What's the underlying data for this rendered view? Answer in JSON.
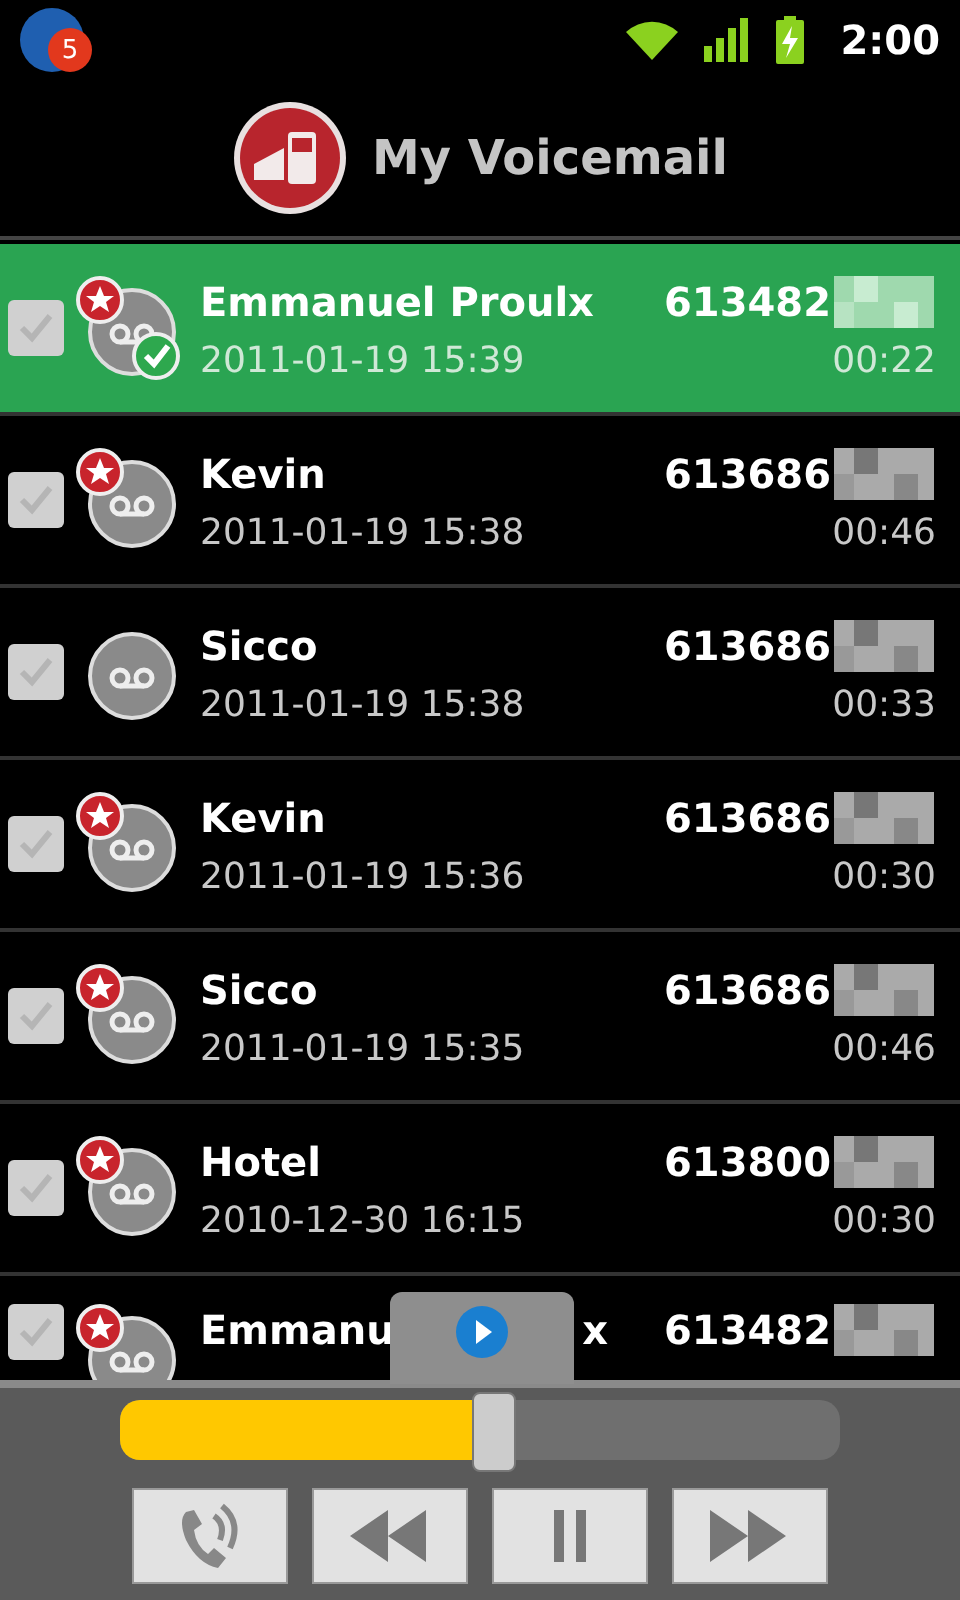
{
  "status_bar": {
    "notification_count": "5",
    "time": "2:00"
  },
  "header": {
    "title": "My Voicemail"
  },
  "messages": [
    {
      "kind": "full",
      "name": "Emmanuel Proulx",
      "number": "613482",
      "date": "2011-01-19 15:39",
      "duration": "00:22",
      "selected": true,
      "starred": true,
      "listened": true
    },
    {
      "kind": "full",
      "name": "Kevin",
      "number": "613686",
      "date": "2011-01-19 15:38",
      "duration": "00:46",
      "selected": false,
      "starred": true,
      "listened": false
    },
    {
      "kind": "full",
      "name": "Sicco",
      "number": "613686",
      "date": "2011-01-19 15:38",
      "duration": "00:33",
      "selected": false,
      "starred": false,
      "listened": false
    },
    {
      "kind": "full",
      "name": "Kevin",
      "number": "613686",
      "date": "2011-01-19 15:36",
      "duration": "00:30",
      "selected": false,
      "starred": true,
      "listened": false
    },
    {
      "kind": "full",
      "name": "Sicco",
      "number": "613686",
      "date": "2011-01-19 15:35",
      "duration": "00:46",
      "selected": false,
      "starred": true,
      "listened": false
    },
    {
      "kind": "full",
      "name": "Hotel",
      "number": "613800",
      "date": "2010-12-30 16:15",
      "duration": "00:30",
      "selected": false,
      "starred": true,
      "listened": false
    },
    {
      "kind": "partial",
      "name": "Emmanu",
      "name_tail": "x",
      "number": "613482",
      "selected": false,
      "starred": true,
      "listened": false
    }
  ],
  "player": {
    "level": 0.52
  }
}
